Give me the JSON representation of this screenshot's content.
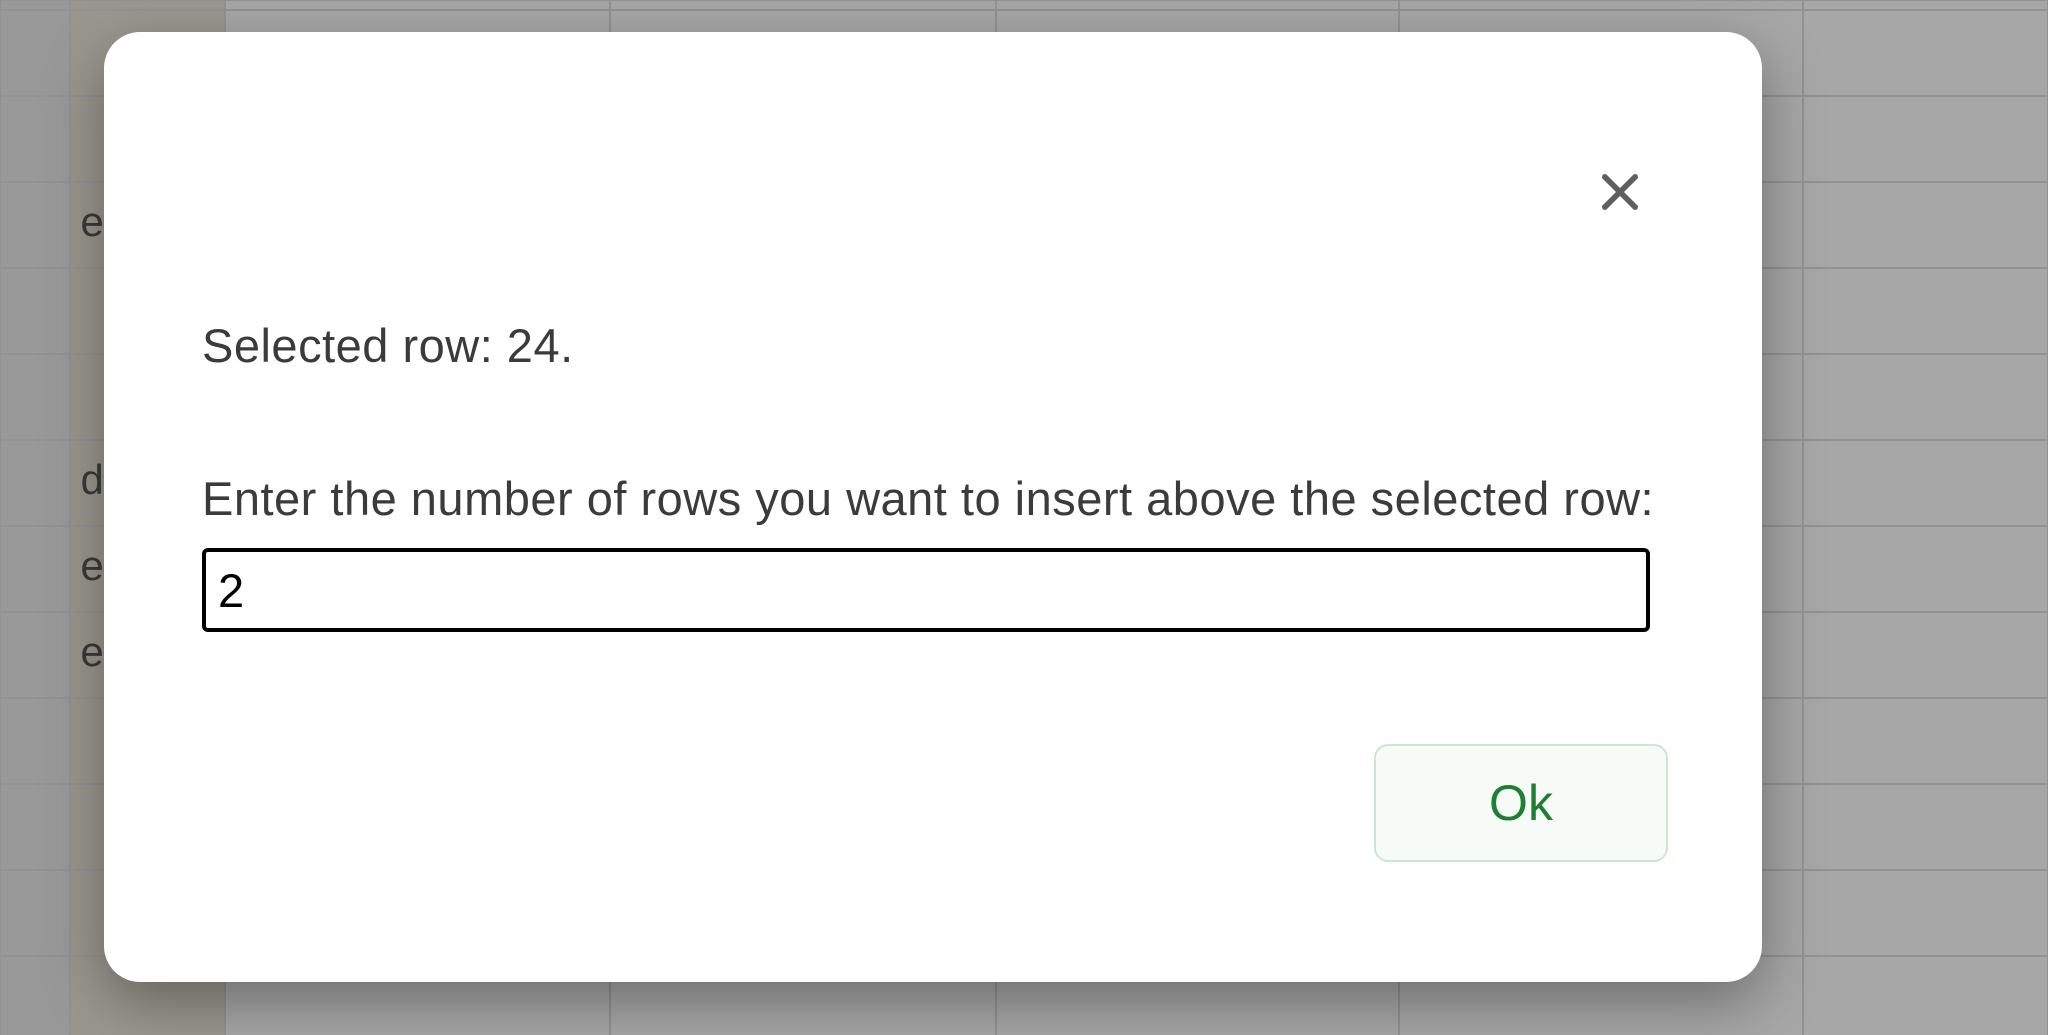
{
  "background": {
    "visible_text_fragments": {
      "row3_colA_fragment": "e",
      "row6_colA_fragment": "d Ki",
      "row7_colA_fragment": "e",
      "row8_colA_fragment": "e"
    }
  },
  "dialog": {
    "selected_row_text": "Selected row: 24.",
    "prompt_text": "Enter the number of rows you want to insert above the selected row:",
    "input_value": "2",
    "ok_label": "Ok",
    "close_icon_name": "close-icon"
  }
}
